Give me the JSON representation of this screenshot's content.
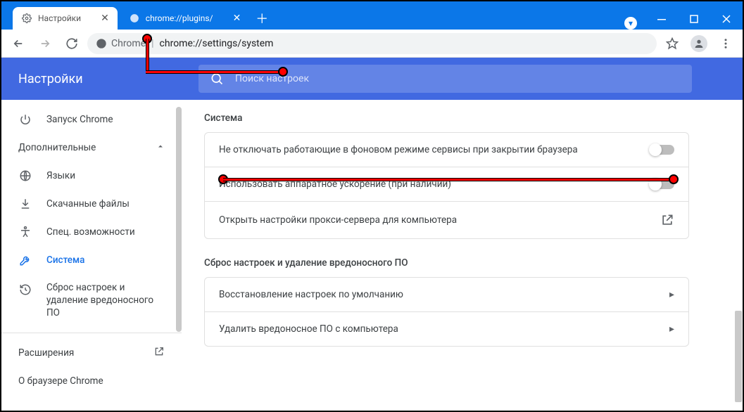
{
  "window": {
    "tabs": [
      {
        "title": "Настройки",
        "active": true
      },
      {
        "title": "chrome://plugins/",
        "active": false
      }
    ],
    "badge_glyph": "▾"
  },
  "addressbar": {
    "security_label": "Chrome",
    "url": "chrome://settings/system"
  },
  "settings_header": {
    "title": "Настройки",
    "search_placeholder": "Поиск настроек"
  },
  "sidebar": {
    "top_item": {
      "label": "Запуск Chrome"
    },
    "group_label": "Дополнительные",
    "items": [
      {
        "label": "Языки"
      },
      {
        "label": "Скачанные файлы"
      },
      {
        "label": "Спец. возможности"
      },
      {
        "label": "Система"
      },
      {
        "label": "Сброс настроек и удаление вредоносного ПО"
      }
    ],
    "extensions_label": "Расширения",
    "about_label": "О браузере Chrome"
  },
  "main": {
    "section1_title": "Система",
    "row_bg_apps": "Не отключать работающие в фоновом режиме сервисы при закрытии браузера",
    "row_hw_accel": "Использовать аппаратное ускорение (при наличии)",
    "row_proxy": "Открыть настройки прокси-сервера для компьютера",
    "section2_title": "Сброс настроек и удаление вредоносного ПО",
    "row_restore": "Восстановление настроек по умолчанию",
    "row_cleanup": "Удалить вредоносное ПО с компьютера"
  }
}
